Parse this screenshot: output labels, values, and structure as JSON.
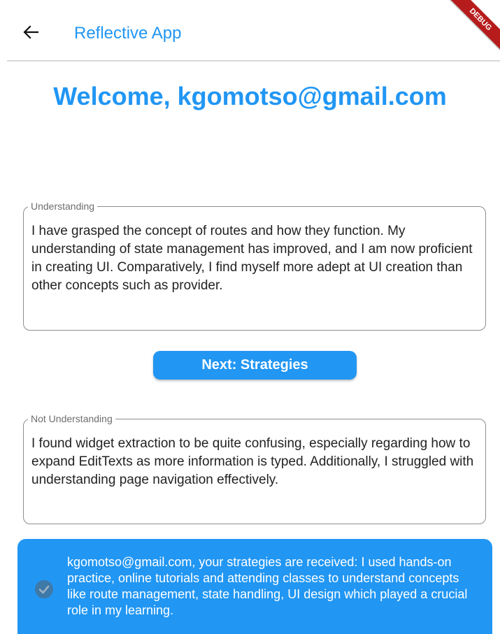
{
  "appbar": {
    "title": "Reflective App",
    "back_icon": "arrow-left-icon",
    "debug_label": "DEBUG"
  },
  "welcome": {
    "text": "Welcome, kgomotso@gmail.com"
  },
  "understanding": {
    "label": "Understanding",
    "value": "I have grasped the concept of routes and how they function. My understanding of state management has improved, and I am now proficient in creating UI. Comparatively, I find myself more adept at UI creation than other concepts such as provider."
  },
  "next_button": {
    "label": "Next: Strategies"
  },
  "not_understanding": {
    "label": "Not Understanding",
    "value": "I found widget extraction to be quite confusing, especially regarding how to expand EditTexts as more information is typed. Additionally, I struggled with understanding page navigation effectively."
  },
  "snackbar": {
    "icon": "check-circle-icon",
    "message": "kgomotso@gmail.com, your strategies are received: I used hands-on practice, online tutorials and attending classes to understand concepts like route management, state handling, UI design which played a crucial role in my learning."
  },
  "colors": {
    "primary": "#2196f3",
    "debug": "#b71c1c",
    "border": "#8e8e8e"
  }
}
